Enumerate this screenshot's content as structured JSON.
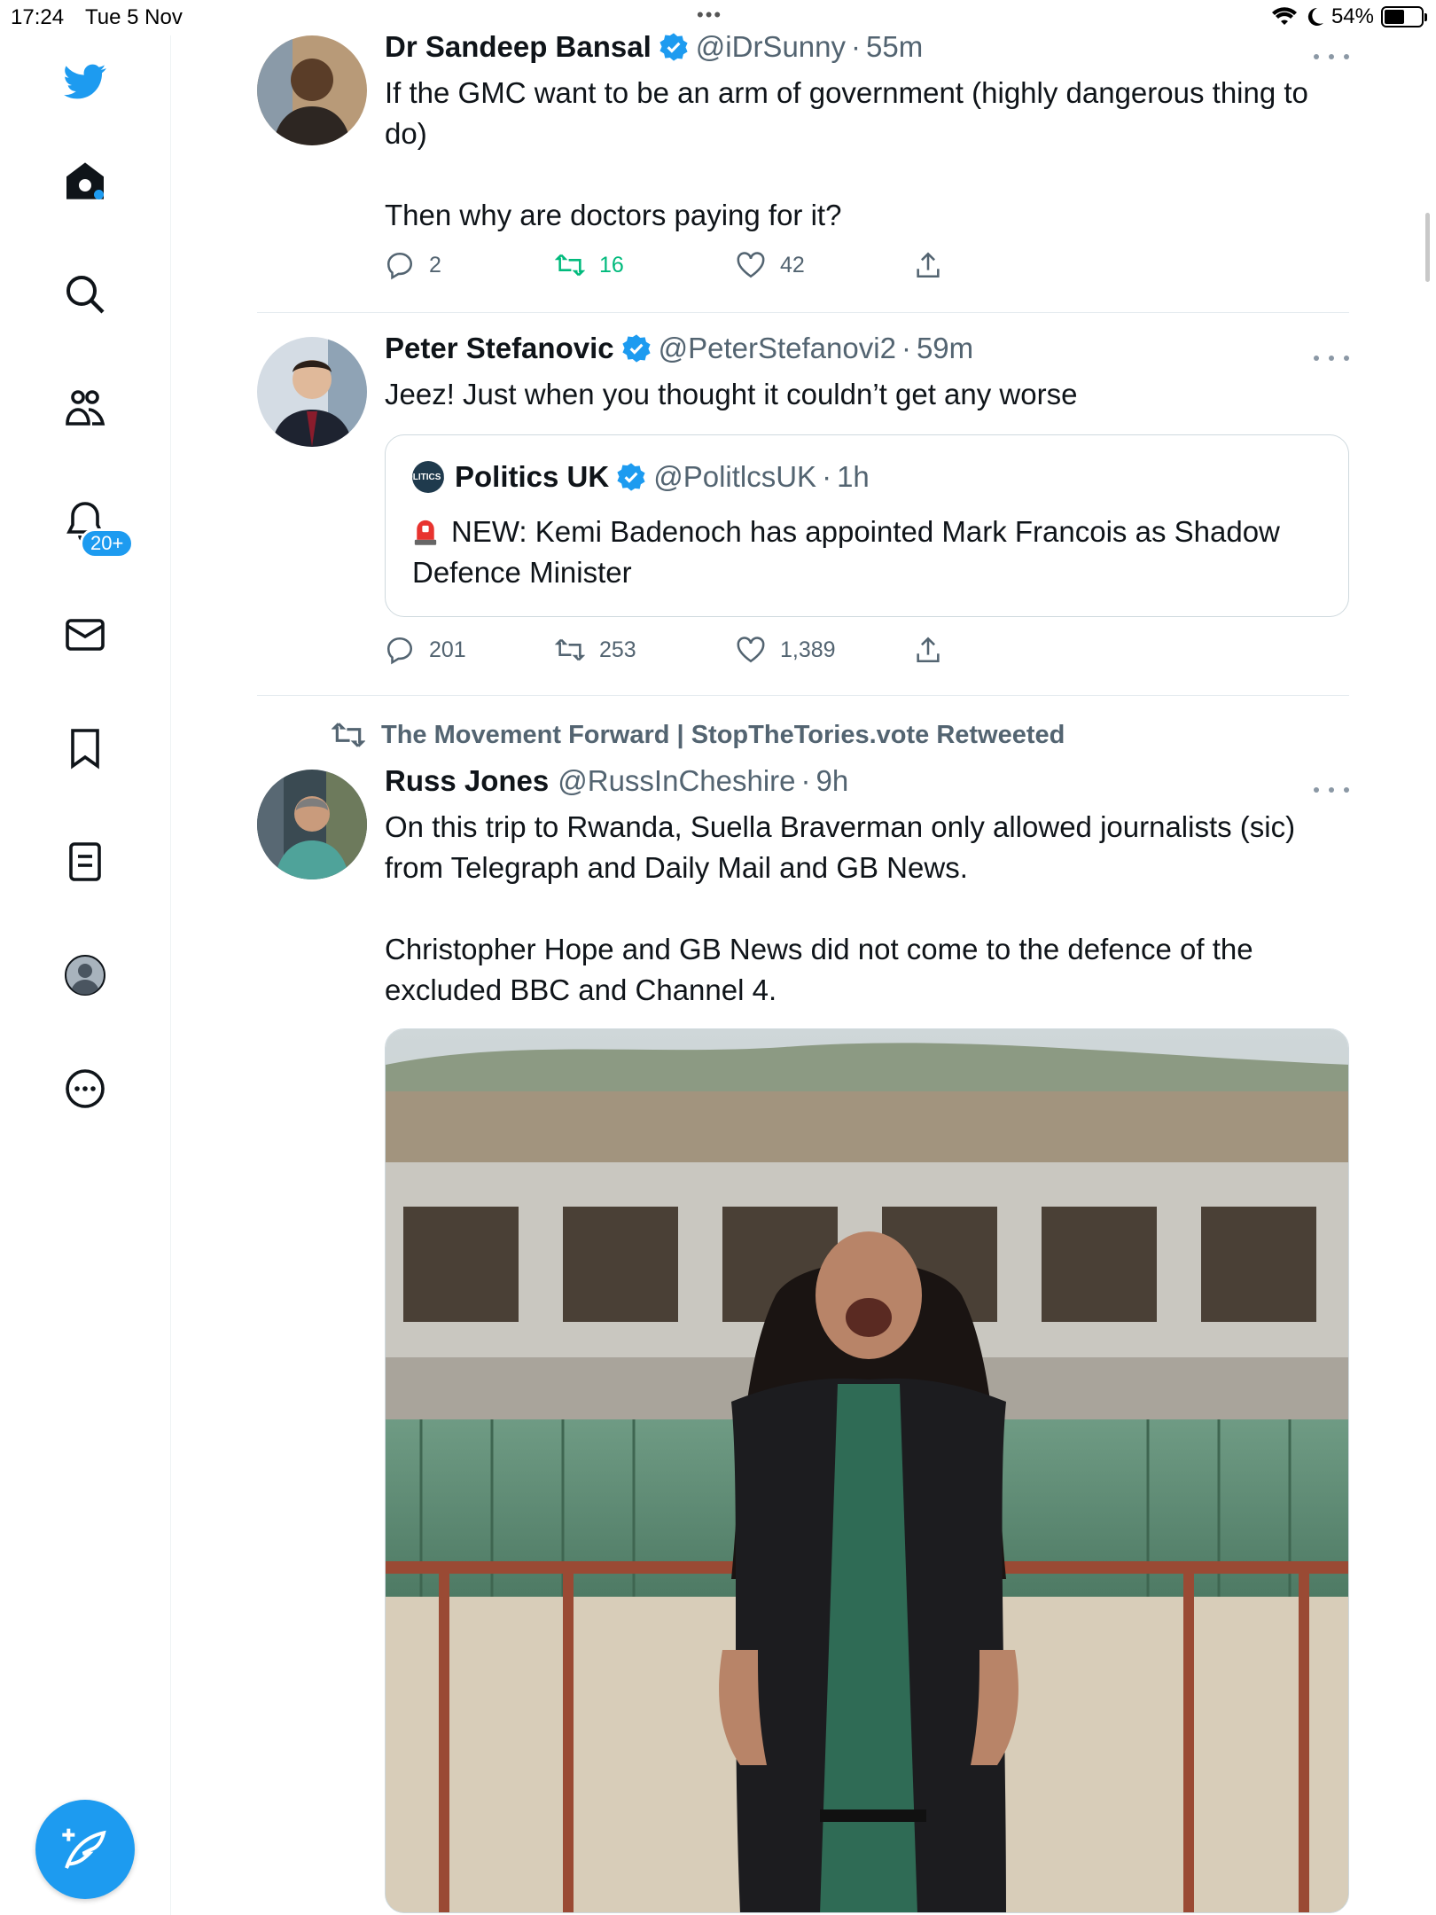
{
  "status_bar": {
    "time": "17:24",
    "date": "Tue 5 Nov",
    "battery": "54%",
    "battery_level": 0.54
  },
  "sidebar": {
    "items": [
      {
        "icon": "twitter-bird-icon"
      },
      {
        "icon": "home-icon",
        "has_new": true
      },
      {
        "icon": "search-icon"
      },
      {
        "icon": "communities-icon"
      },
      {
        "icon": "notifications-icon",
        "badge": "20+"
      },
      {
        "icon": "messages-icon"
      },
      {
        "icon": "bookmarks-icon"
      },
      {
        "icon": "lists-icon"
      },
      {
        "icon": "profile-icon"
      },
      {
        "icon": "more-options-icon"
      }
    ],
    "compose_icon": "compose-tweet-icon",
    "accent_color": "#1d9bf0"
  },
  "tweets": [
    {
      "name": "Dr Sandeep Bansal",
      "handle": "@iDrSunny",
      "sep": "·",
      "time": "55m",
      "text": "If the GMC want to be an arm of government (highly dangerous thing to do)\n\nThen why are doctors paying for it?",
      "replies": "2",
      "retweets": "16",
      "likes": "42"
    },
    {
      "name": "Peter Stefanovic",
      "handle": "@PeterStefanovi2",
      "sep": "·",
      "time": "59m",
      "text": "Jeez! Just when you thought it couldn’t get any worse",
      "quote": {
        "avatar_text": "POLITICS UK",
        "name": "Politics UK",
        "handle": "@PolitlcsUK",
        "sep": "·",
        "time": "1h",
        "text": "NEW: Kemi Badenoch has appointed Mark Francois as Shadow Defence Minister"
      },
      "replies": "201",
      "retweets": "253",
      "likes": "1,389"
    },
    {
      "retweeted_by": "The Movement Forward | StopTheTories.vote Retweeted",
      "name": "Russ Jones",
      "handle": "@RussInCheshire",
      "sep": "·",
      "time": "9h",
      "text": "On this trip to Rwanda, Suella Braverman only allowed journalists (sic) from Telegraph and Daily Mail and GB News.\n\nChristopher Hope and GB News did not come to the defence of the excluded BBC and Channel 4."
    }
  ]
}
